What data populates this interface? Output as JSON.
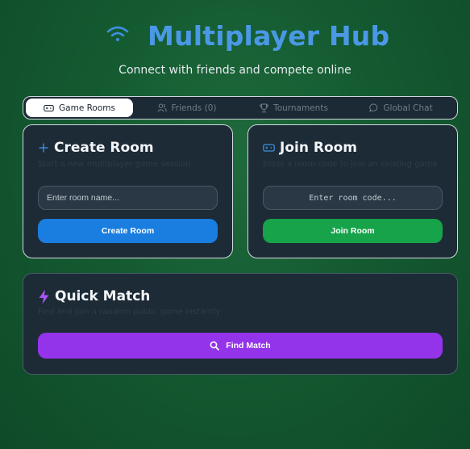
{
  "header": {
    "title": "Multiplayer Hub",
    "subtitle": "Connect with friends and compete online",
    "icon": "wifi-icon"
  },
  "tabs": [
    {
      "label": "Game Rooms",
      "icon": "gamepad-icon",
      "active": true
    },
    {
      "label": "Friends (0)",
      "icon": "users-icon",
      "active": false
    },
    {
      "label": "Tournaments",
      "icon": "trophy-icon",
      "active": false
    },
    {
      "label": "Global Chat",
      "icon": "chat-icon",
      "active": false
    }
  ],
  "create_room": {
    "title": "Create Room",
    "description": "Start a new multiplayer game session",
    "input_placeholder": "Enter room name...",
    "input_value": "",
    "button_label": "Create Room"
  },
  "join_room": {
    "title": "Join Room",
    "description": "Enter a room code to join an existing game",
    "input_placeholder": "Enter room code...",
    "input_value": "",
    "button_label": "Join Room"
  },
  "quick_match": {
    "title": "Quick Match",
    "description": "Find and join a random public game instantly",
    "button_label": "Find Match"
  },
  "colors": {
    "title_blue": "#4a98e6",
    "create_button": "#1a7de0",
    "join_button": "#16a34a",
    "find_button": "#9333ea",
    "quick_icon": "#a855f7"
  }
}
